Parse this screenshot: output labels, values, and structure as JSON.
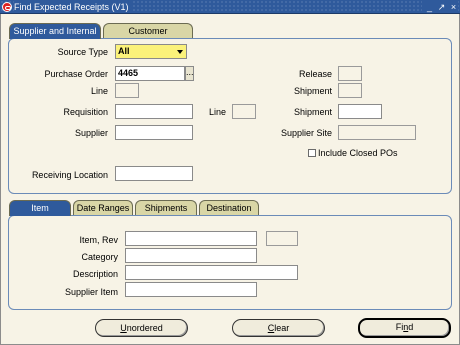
{
  "window": {
    "title": "Find Expected Receipts (V1)",
    "controls": [
      "_",
      "↗",
      "×"
    ]
  },
  "top_tabs": [
    {
      "label": "Supplier and Internal",
      "active": true
    },
    {
      "label": "Customer",
      "active": false
    }
  ],
  "top_panel": {
    "source_type": {
      "label": "Source Type",
      "value": "All"
    },
    "purchase_order": {
      "label": "Purchase Order",
      "value": "4465",
      "lov": "..."
    },
    "release": {
      "label": "Release",
      "value": ""
    },
    "line": {
      "label": "Line",
      "value": ""
    },
    "shipment_po": {
      "label": "Shipment",
      "value": ""
    },
    "requisition": {
      "label": "Requisition",
      "value": ""
    },
    "req_line": {
      "label": "Line",
      "value": ""
    },
    "req_shipment": {
      "label": "Shipment",
      "value": ""
    },
    "supplier": {
      "label": "Supplier",
      "value": ""
    },
    "supplier_site": {
      "label": "Supplier Site",
      "value": ""
    },
    "include_closed": {
      "label": "Include Closed POs",
      "checked": false
    },
    "receiving_location": {
      "label": "Receiving Location",
      "value": ""
    }
  },
  "bottom_tabs": [
    {
      "label": "Item",
      "active": true
    },
    {
      "label": "Date Ranges",
      "active": false
    },
    {
      "label": "Shipments",
      "active": false
    },
    {
      "label": "Destination",
      "active": false
    }
  ],
  "bottom_panel": {
    "item_rev": {
      "label": "Item, Rev",
      "value": "",
      "rev": ""
    },
    "category": {
      "label": "Category",
      "value": ""
    },
    "description": {
      "label": "Description",
      "value": ""
    },
    "supplier_item": {
      "label": "Supplier Item",
      "value": ""
    }
  },
  "buttons": {
    "unordered": {
      "mnemonic": "U",
      "rest": "nordered"
    },
    "clear": {
      "mnemonic": "C",
      "rest": "lear"
    },
    "find": {
      "pre": "Fi",
      "mnemonic": "n",
      "rest": "d"
    }
  }
}
